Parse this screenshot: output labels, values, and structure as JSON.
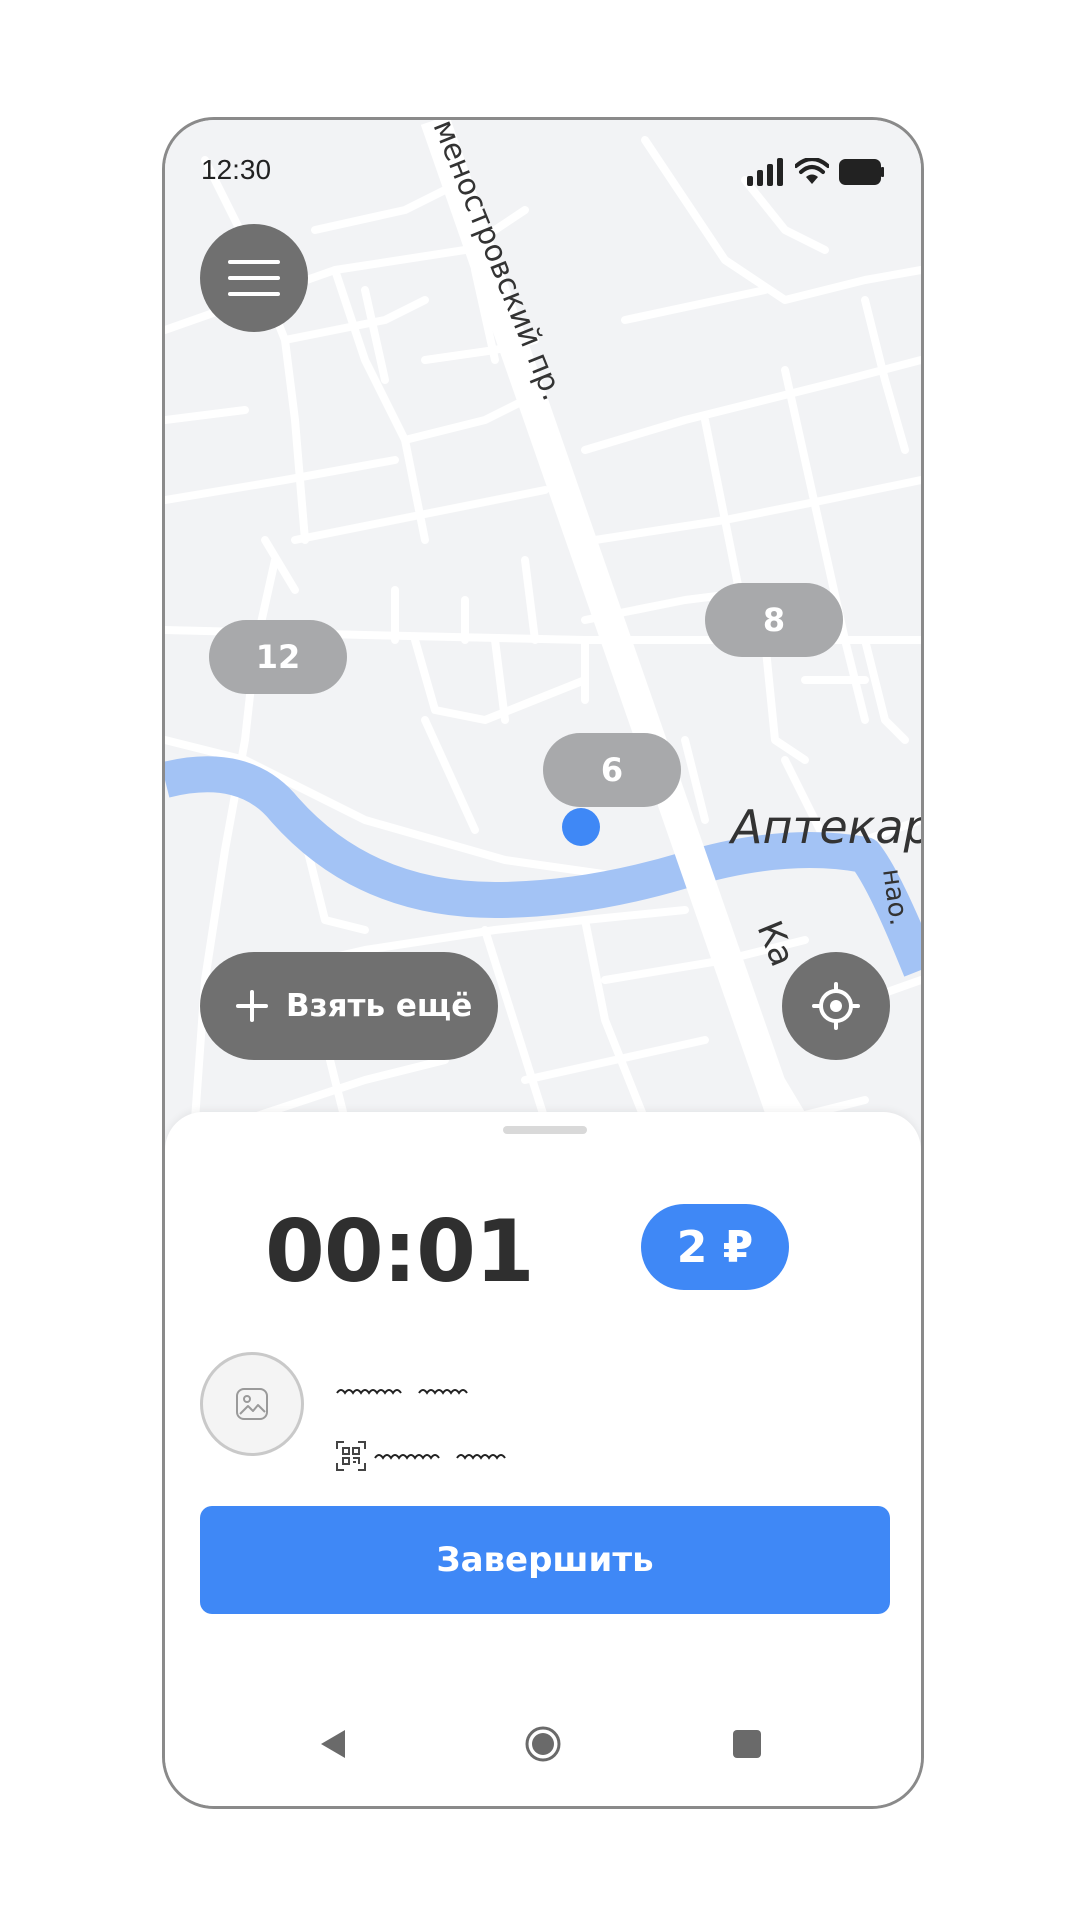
{
  "status_bar": {
    "time": "12:30"
  },
  "map": {
    "street_labels": [
      "меностровский пр.",
      "Аптекар",
      "Ка",
      "нао."
    ],
    "clusters": [
      {
        "label": "12"
      },
      {
        "label": "8"
      },
      {
        "label": "6"
      }
    ]
  },
  "take_more_button": {
    "label": "Взять ещё"
  },
  "ride": {
    "timer": "00:01",
    "price": "2 ₽"
  },
  "finish_button": {
    "label": "Завершить"
  },
  "colors": {
    "accent": "#3f88f6",
    "fab": "#707070",
    "cluster": "#a8a9ab",
    "water": "#a3c3f5"
  }
}
